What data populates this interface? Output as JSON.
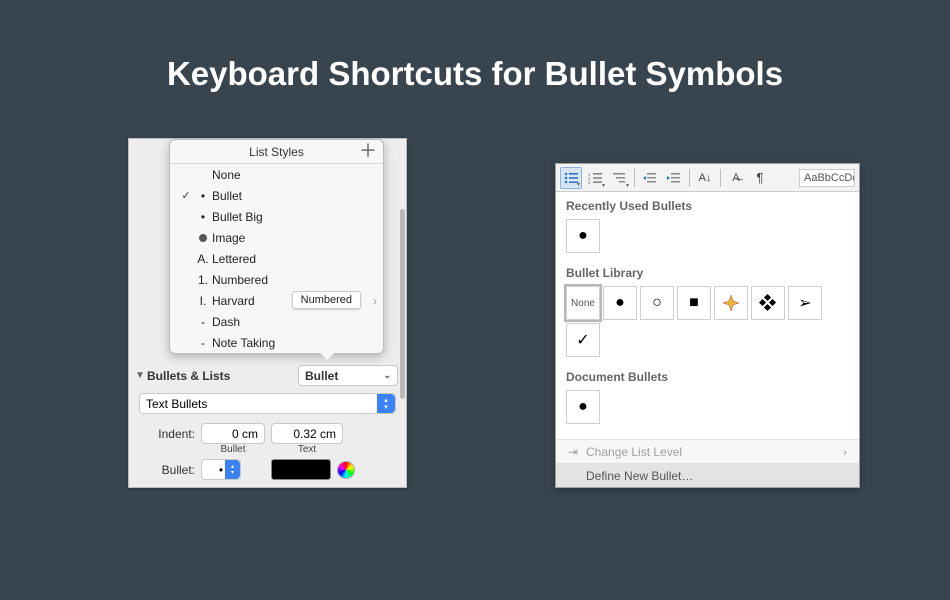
{
  "title": "Keyboard Shortcuts for Bullet Symbols",
  "mac": {
    "popover_title": "List Styles",
    "items": [
      {
        "icon": "",
        "label": "None",
        "checked": false
      },
      {
        "icon": "•",
        "label": "Bullet",
        "checked": true
      },
      {
        "icon": "•",
        "label": "Bullet Big",
        "checked": false
      },
      {
        "icon": "●",
        "label": "Image",
        "checked": false,
        "image": true
      },
      {
        "icon": "A.",
        "label": "Lettered",
        "checked": false
      },
      {
        "icon": "1.",
        "label": "Numbered",
        "checked": false
      },
      {
        "icon": "I.",
        "label": "Harvard",
        "checked": false,
        "tooltip": "Numbered",
        "disclosure": true
      },
      {
        "icon": "-",
        "label": "Dash",
        "checked": false
      },
      {
        "icon": "-",
        "label": "Note Taking",
        "checked": false
      }
    ],
    "section_label": "Bullets & Lists",
    "style_dropdown": "Bullet",
    "type_dropdown": "Text Bullets",
    "indent_label": "Indent:",
    "indent_bullet": "0 cm",
    "indent_text": "0.32 cm",
    "col_bullet": "Bullet",
    "col_text": "Text",
    "bullet_row_label": "Bullet:",
    "bullet_char": "•"
  },
  "word": {
    "ribbon_style_preview": "AaBbCcDc",
    "sections": {
      "recent": "Recently Used Bullets",
      "library": "Bullet Library",
      "document": "Document Bullets"
    },
    "recent": [
      "●"
    ],
    "library": [
      {
        "txt": "None",
        "none": true
      },
      {
        "glyph": "●"
      },
      {
        "glyph": "○"
      },
      {
        "glyph": "■"
      },
      {
        "glyph": "plus4",
        "svg": true
      },
      {
        "glyph": "diamond4",
        "svg": true
      },
      {
        "glyph": "➢"
      },
      {
        "glyph": "✓"
      }
    ],
    "document": [
      "●"
    ],
    "footer": {
      "change_level": "Change List Level",
      "define_new": "Define New Bullet…"
    }
  }
}
